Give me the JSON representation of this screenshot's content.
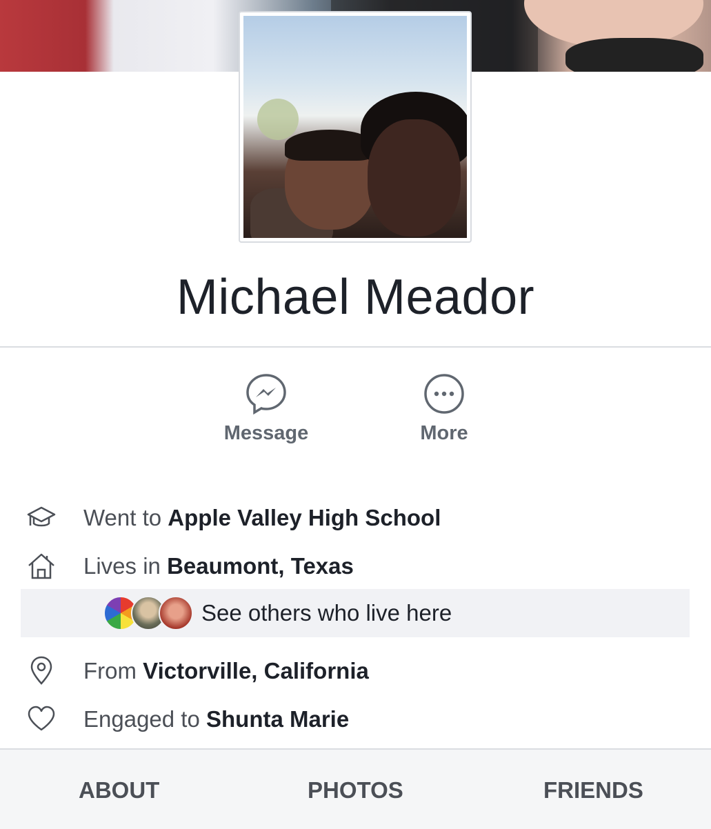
{
  "profile": {
    "name": "Michael Meador"
  },
  "actions": {
    "message_label": "Message",
    "more_label": "More"
  },
  "info": {
    "education": {
      "prefix": "Went to ",
      "value": "Apple Valley High School",
      "icon": "graduation-cap-icon"
    },
    "residence": {
      "prefix": "Lives in ",
      "value": "Beaumont, Texas",
      "icon": "home-icon"
    },
    "see_others": "See others who live here",
    "hometown": {
      "prefix": "From ",
      "value": "Victorville, California",
      "icon": "location-pin-icon"
    },
    "relationship": {
      "prefix": "Engaged to ",
      "value": "Shunta Marie",
      "icon": "heart-icon"
    }
  },
  "tabs": {
    "about": "ABOUT",
    "photos": "PHOTOS",
    "friends": "FRIENDS"
  },
  "colors": {
    "text_dark": "#1d2129",
    "text_muted": "#606770",
    "divider": "#dadde1",
    "tab_bg": "#f5f6f7"
  }
}
